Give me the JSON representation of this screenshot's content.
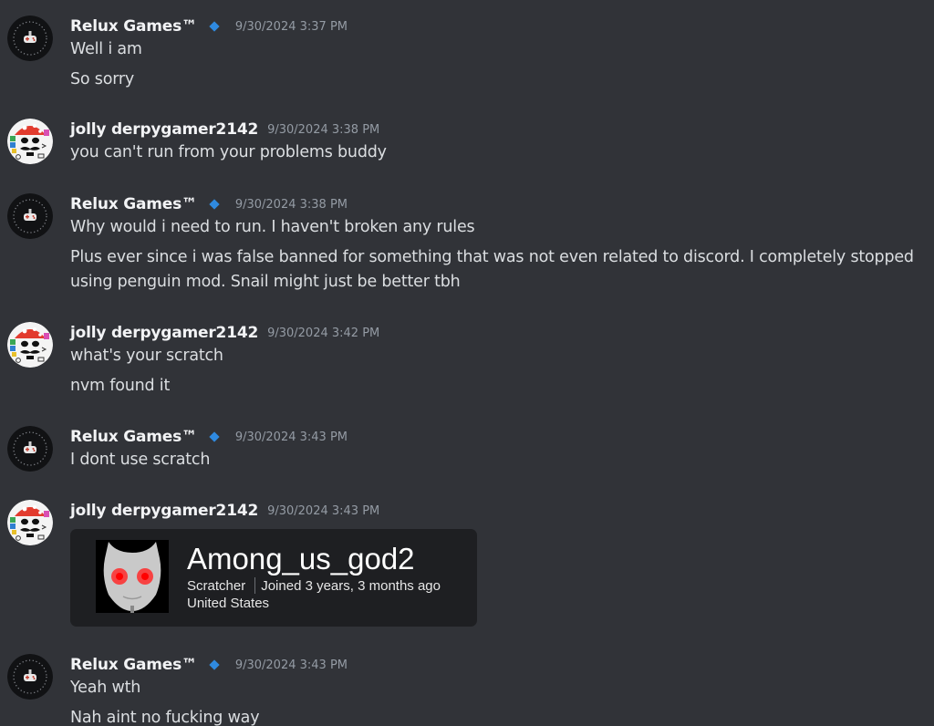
{
  "users": {
    "relux": {
      "name": "Relux Games™",
      "avatar_icon": "gamepad-avatar-icon",
      "tag_icon": "diamond-badge-icon",
      "tag_color": "#2f8ae0"
    },
    "jolly": {
      "name": "jolly derpygamer2142",
      "avatar_icon": "mushroom-face-avatar-icon"
    }
  },
  "groups": [
    {
      "author": "Relux Games™",
      "timestamp": "9/30/2024 3:37 PM",
      "messages": [
        "Well i am",
        "So sorry"
      ]
    },
    {
      "author": "jolly derpygamer2142",
      "timestamp": "9/30/2024 3:38 PM",
      "messages": [
        "you can't run from your problems buddy"
      ]
    },
    {
      "author": "Relux Games™",
      "timestamp": "9/30/2024 3:38 PM",
      "messages": [
        "Why would i need to run. I haven't broken any rules",
        "Plus ever since i was false banned for something that was not even related to discord. I completely stopped using penguin mod. Snail might just be better tbh"
      ]
    },
    {
      "author": "jolly derpygamer2142",
      "timestamp": "9/30/2024 3:42 PM",
      "messages": [
        "what's your scratch",
        "nvm found it"
      ]
    },
    {
      "author": "Relux Games™",
      "timestamp": "9/30/2024 3:43 PM",
      "messages": [
        "I dont use scratch"
      ]
    },
    {
      "author": "jolly derpygamer2142",
      "timestamp": "9/30/2024 3:43 PM",
      "embed": {
        "title": "Among_us_god2",
        "role": "Scratcher",
        "joined": "Joined 3 years, 3 months ago",
        "location": "United States",
        "thumbnail_icon": "profile-picture-icon"
      }
    },
    {
      "author": "Relux Games™",
      "timestamp": "9/30/2024 3:43 PM",
      "messages": [
        "Yeah wth",
        "Nah aint no fucking way"
      ]
    }
  ],
  "colors": {
    "background": "#313338",
    "text": "#dbdee1",
    "username": "#f2f3f5",
    "timestamp": "#949ba4",
    "embed_bg": "#1e1f22"
  }
}
